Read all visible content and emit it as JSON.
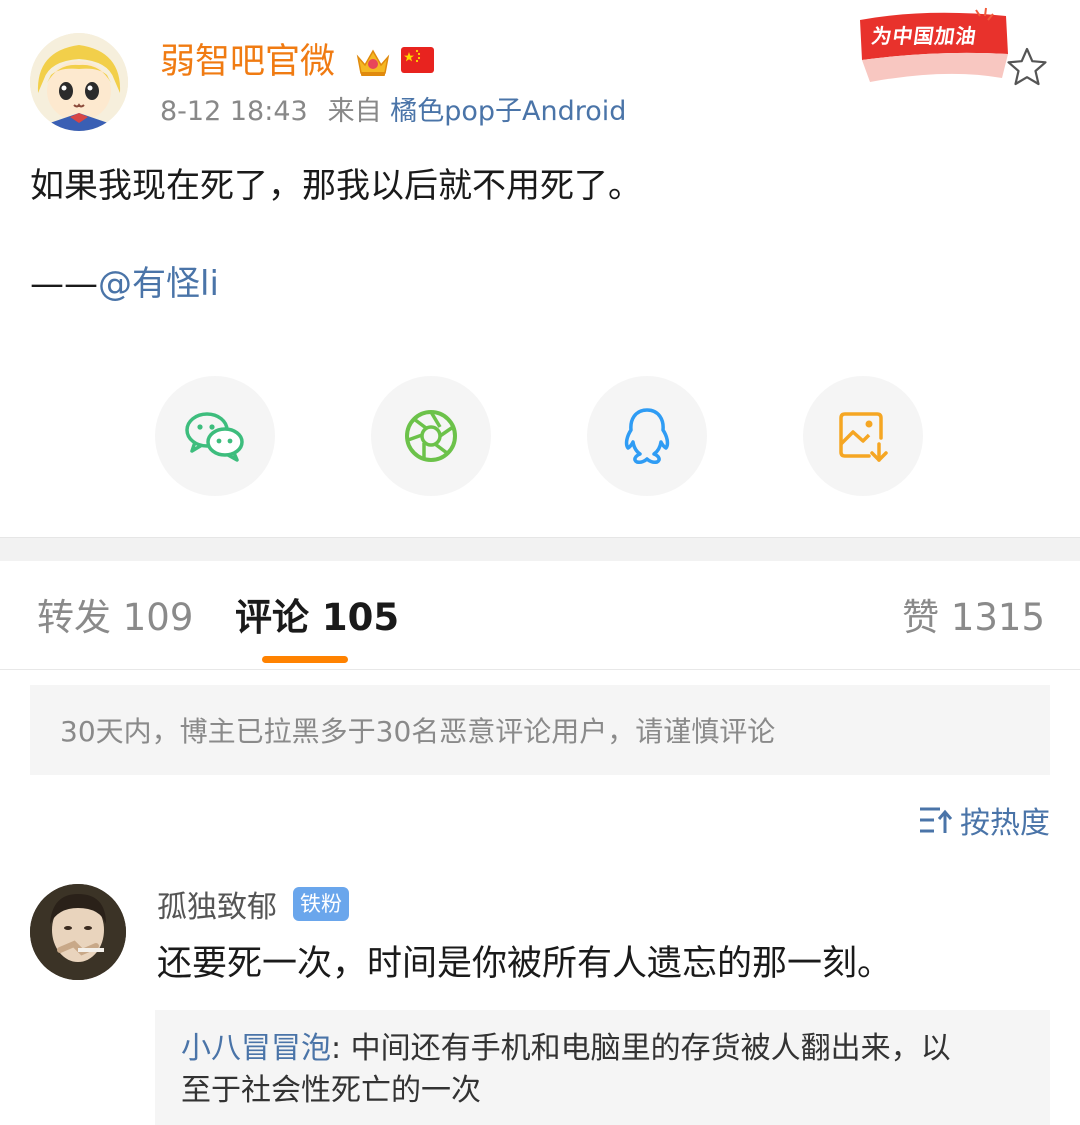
{
  "post": {
    "author": "弱智吧官微",
    "time": "8-12 18:43",
    "source_prefix": "来自",
    "source": "橘色pop子Android",
    "badge_text": "为中国加油",
    "text": "如果我现在死了，那我以后就不用死了。",
    "credit_dash": "——",
    "credit_mention": "@有怪li",
    "icons": {
      "avatar": "anime-girl-avatar",
      "vip": "crown-icon",
      "flag": "china-flag-icon",
      "favorite": "star-icon"
    }
  },
  "share": [
    {
      "name": "wechat-icon",
      "color": "#3dbd7d"
    },
    {
      "name": "moments-icon",
      "color": "#6cc24a"
    },
    {
      "name": "qq-icon",
      "color": "#2f9cf4"
    },
    {
      "name": "save-image-icon",
      "color": "#f5a623"
    }
  ],
  "tabs": {
    "repost": "转发 109",
    "comment": "评论 105",
    "like": "赞 1315",
    "accent": "#ff8200"
  },
  "notice": "30天内，博主已拉黑多于30名恶意评论用户，请谨慎评论",
  "sort_label": "按热度",
  "comment": {
    "user": "孤独致郁",
    "badge": "铁粉",
    "text": "还要死一次，时间是你被所有人遗忘的那一刻。",
    "reply_author": "小八冒冒泡",
    "reply_sep": ": ",
    "reply_line1": "中间还有手机和电脑里的存货被人翻出来，以",
    "reply_line2": "至于社会性死亡的一次"
  },
  "colors": {
    "link": "#4a74a8",
    "author": "#f07b12",
    "fan_badge": "#6aa6ec"
  }
}
